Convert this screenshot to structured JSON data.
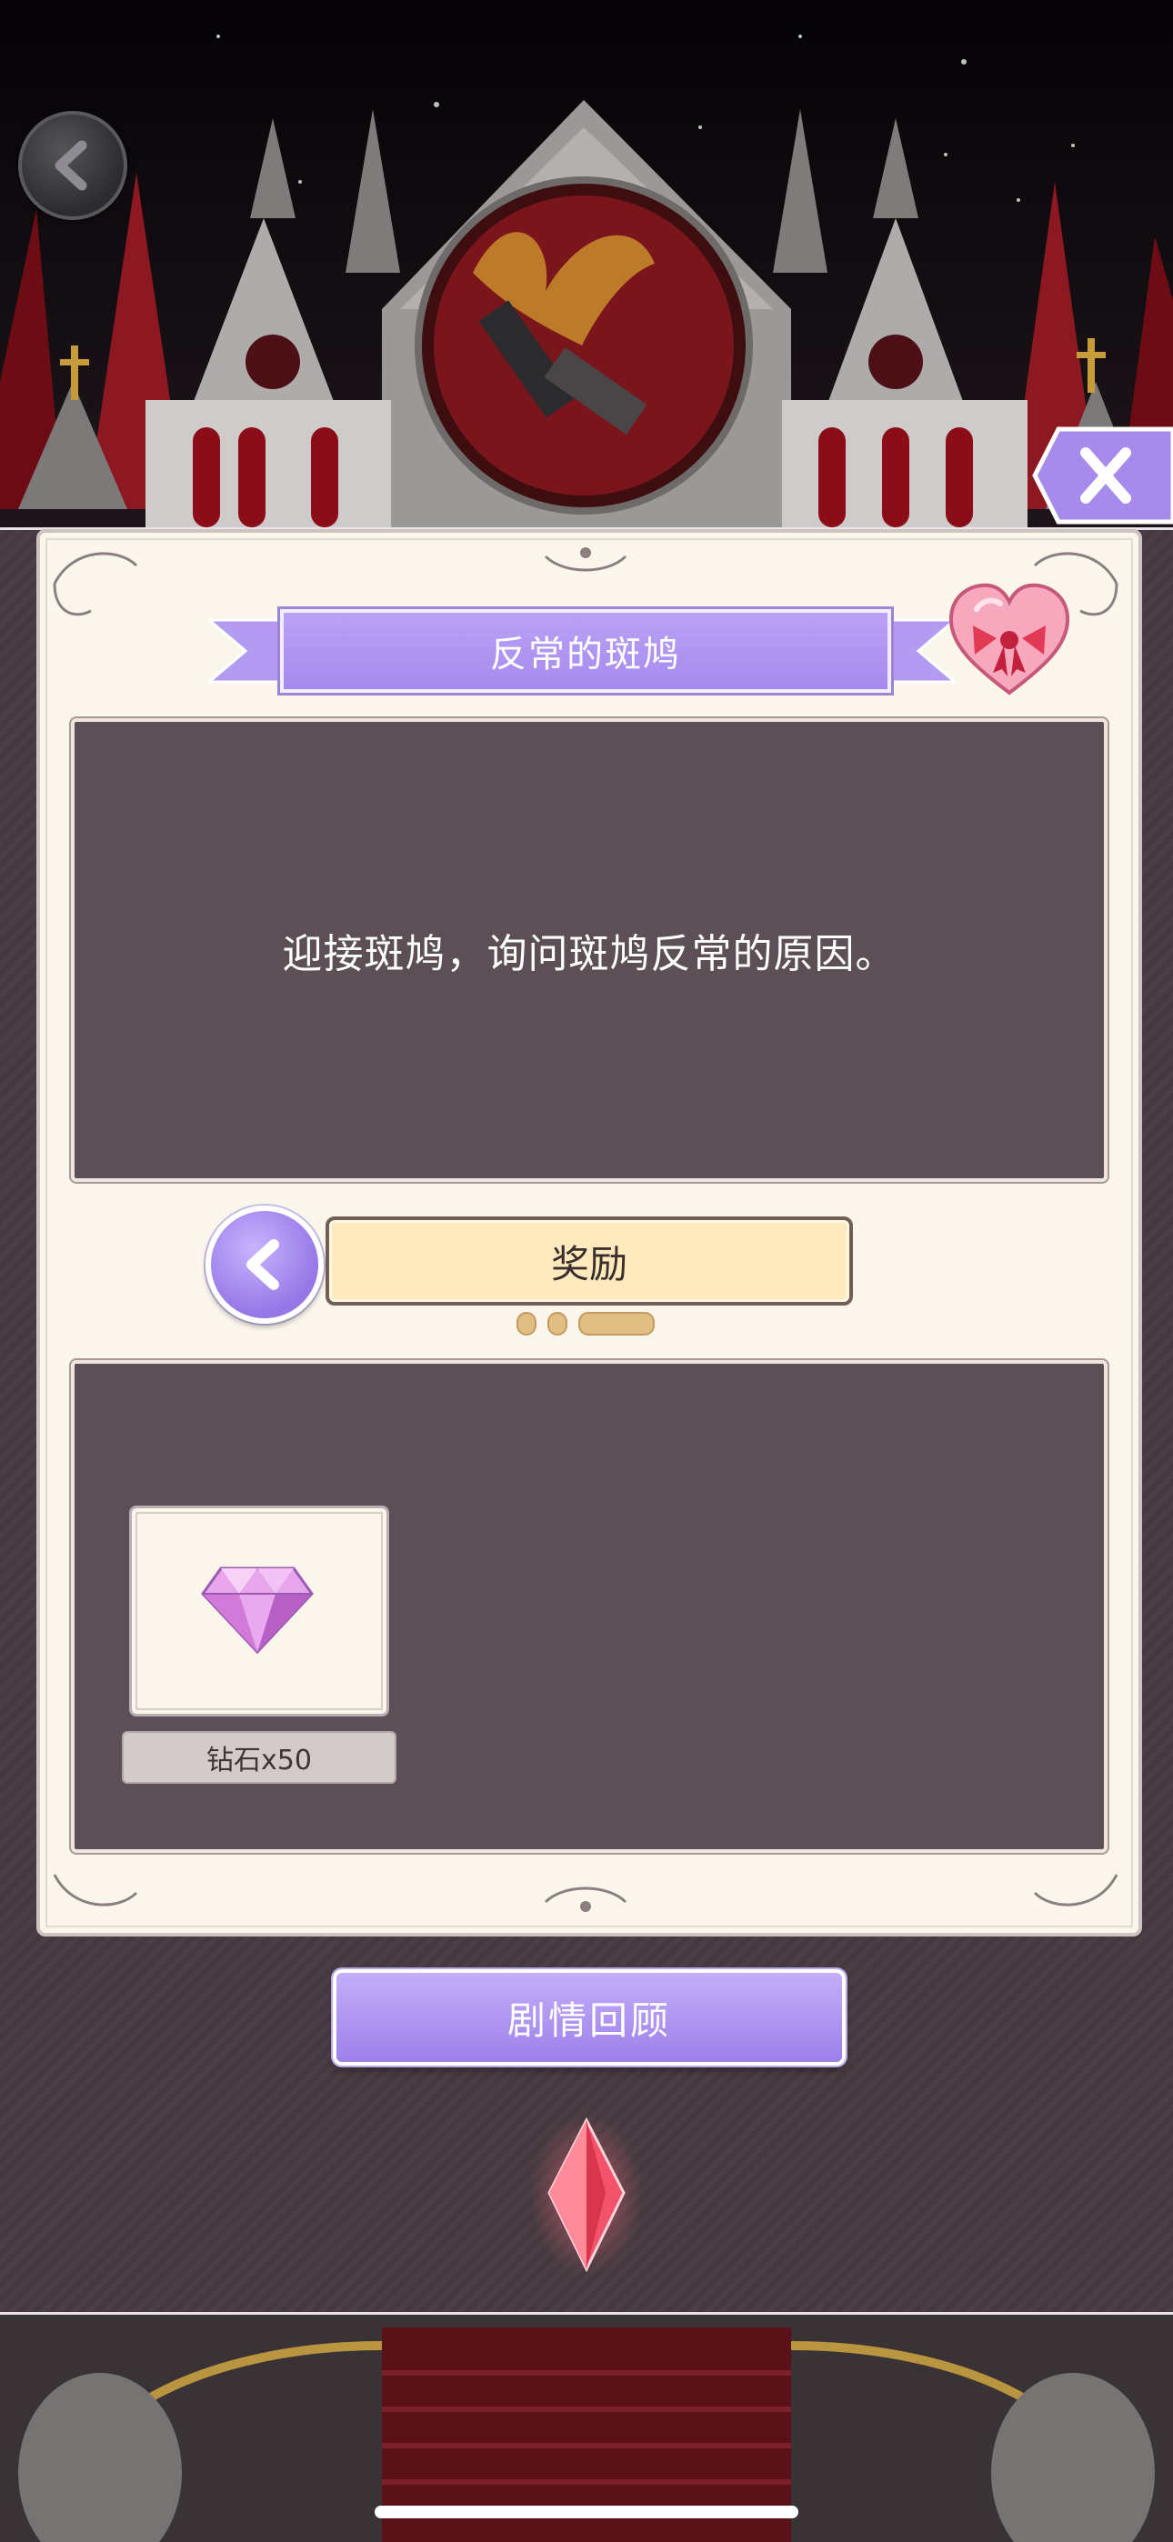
{
  "quest": {
    "title": "反常的斑鸠",
    "description": "迎接斑鸠，询问斑鸠反常的原因。"
  },
  "reward_section": {
    "tab_label": "奖励",
    "pager": {
      "total": 3,
      "active": 3
    },
    "items": [
      {
        "icon": "diamond-icon",
        "label": "钻石x50"
      }
    ]
  },
  "buttons": {
    "story_review_label": "剧情回顾"
  },
  "colors": {
    "accent_purple": "#a68aee",
    "panel_dark": "#5d4f56",
    "card_cream": "#fbf6ec",
    "tab_cream": "#ffeac0"
  },
  "icons": {
    "back": "chevron-left-icon",
    "close": "close-icon",
    "heart": "heart-ribbon-icon",
    "gem": "red-crystal-icon"
  }
}
